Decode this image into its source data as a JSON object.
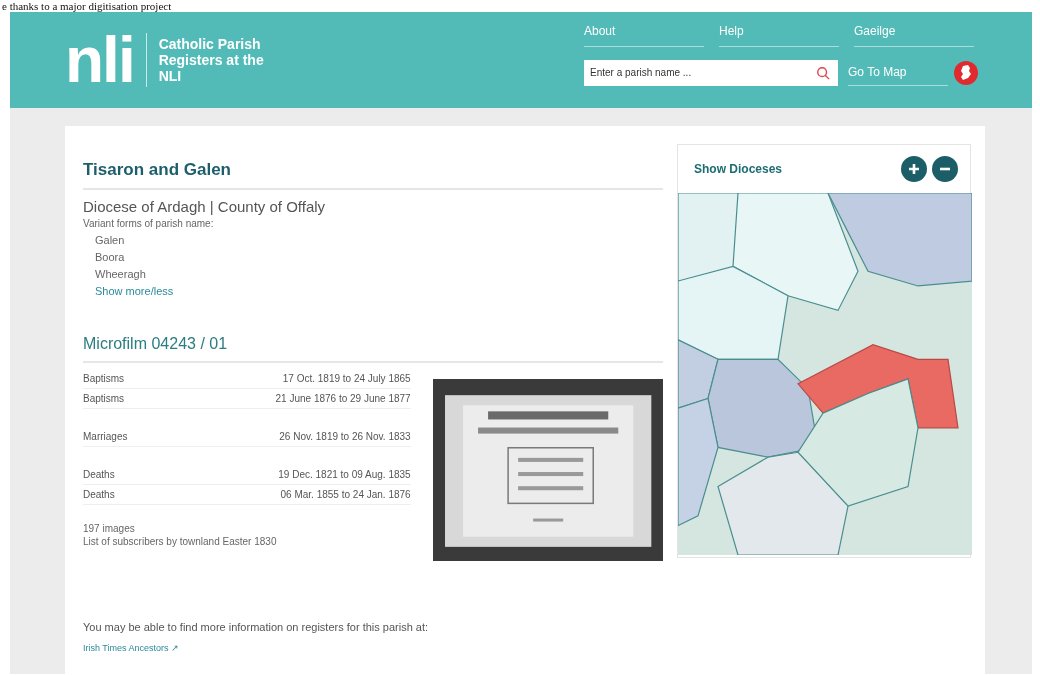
{
  "article_snippet": "e thanks to a major digitisation project",
  "header": {
    "logo": "nli",
    "site_title": "Catholic Parish Registers at the NLI",
    "nav": [
      {
        "label": "About"
      },
      {
        "label": "Help"
      },
      {
        "label": "Gaeilge"
      }
    ],
    "search": {
      "placeholder": "Enter a parish name ..."
    },
    "map_link": "Go To Map"
  },
  "parish": {
    "title": "Tisaron and Galen",
    "location": "Diocese of Ardagh | County of Offaly",
    "variants_label": "Variant forms of parish name:",
    "variants": [
      "Galen",
      "Boora",
      "Wheeragh"
    ],
    "toggle": "Show more/less"
  },
  "microfilm": {
    "title": "Microfilm 04243 / 01",
    "groups": [
      {
        "entries": [
          {
            "type": "Baptisms",
            "range": "17 Oct. 1819 to 24 July 1865"
          },
          {
            "type": "Baptisms",
            "range": "21 June 1876 to 29 June 1877"
          }
        ]
      },
      {
        "entries": [
          {
            "type": "Marriages",
            "range": "26 Nov. 1819 to 26 Nov. 1833"
          }
        ]
      },
      {
        "entries": [
          {
            "type": "Deaths",
            "range": "19 Dec. 1821 to 09 Aug. 1835"
          },
          {
            "type": "Deaths",
            "range": "06 Mar. 1855 to 24 Jan. 1876"
          }
        ]
      }
    ],
    "image_count": "197 images",
    "note": "List of subscribers by townland Easter 1830"
  },
  "more_info": {
    "text": "You may be able to find more information on registers for this parish at:",
    "link": "Irish Times Ancestors ↗"
  },
  "map_panel": {
    "title": "Show Dioceses"
  }
}
